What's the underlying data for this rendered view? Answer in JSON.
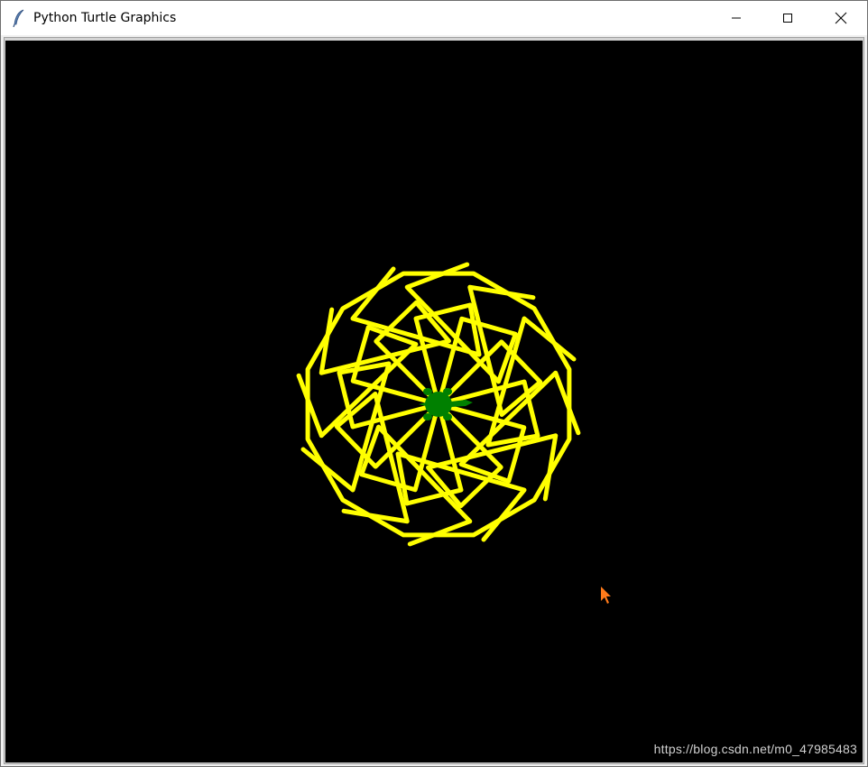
{
  "window": {
    "title": "Python Turtle Graphics",
    "icon": "feather-icon"
  },
  "controls": {
    "minimize": "minimize-icon",
    "maximize": "maximize-icon",
    "close": "close-icon"
  },
  "canvas": {
    "background": "#000000",
    "pen_color": "#ffff00",
    "turtle_color": "#008000",
    "cursor_color": "#ff7a1a"
  },
  "watermark": "https://blog.csdn.net/m0_47985483"
}
